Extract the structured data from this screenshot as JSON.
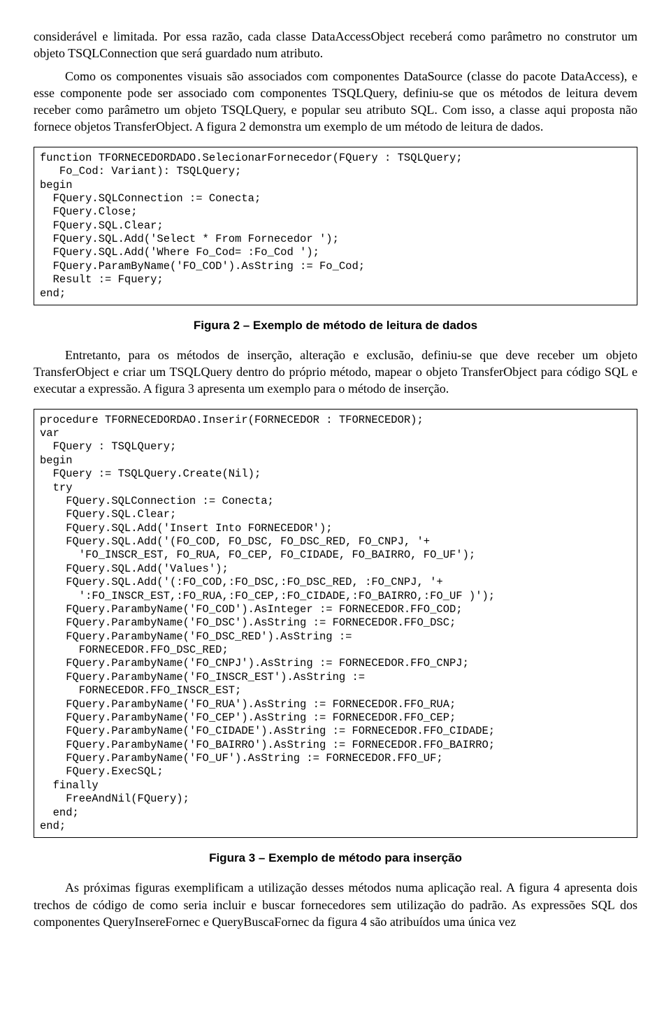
{
  "paragraphs": {
    "p1": "considerável e limitada. Por essa razão, cada classe DataAccessObject receberá como parâmetro no construtor um objeto TSQLConnection que será guardado num atributo.",
    "p2": "Como os componentes visuais são associados com componentes DataSource (classe do pacote DataAccess), e esse componente pode ser associado com componentes TSQLQuery, definiu-se que os métodos de leitura devem receber como parâmetro um objeto TSQLQuery, e popular seu atributo SQL. Com isso, a classe aqui proposta não fornece objetos TransferObject. A figura 2 demonstra um exemplo de um método de leitura de dados.",
    "p3": "Entretanto, para os métodos de inserção, alteração e exclusão, definiu-se que deve receber um objeto TransferObject e criar um TSQLQuery dentro do próprio método, mapear o objeto TransferObject para código SQL e executar a expressão. A figura 3 apresenta um exemplo para o método de inserção.",
    "p4": "As próximas figuras exemplificam a utilização desses métodos numa aplicação real. A figura 4 apresenta dois trechos de código de como seria incluir e buscar fornecedores sem utilização do padrão. As expressões SQL dos componentes QueryInsereFornec e QueryBuscaFornec da figura 4 são atribuídos uma única vez"
  },
  "code": {
    "fig2": "function TFORNECEDORDADO.SelecionarFornecedor(FQuery : TSQLQuery;\n   Fo_Cod: Variant): TSQLQuery;\nbegin\n  FQuery.SQLConnection := Conecta;\n  FQuery.Close;\n  FQuery.SQL.Clear;\n  FQuery.SQL.Add('Select * From Fornecedor ');\n  FQuery.SQL.Add('Where Fo_Cod= :Fo_Cod ');\n  FQuery.ParamByName('FO_COD').AsString := Fo_Cod;\n  Result := Fquery;\nend;",
    "fig3": "procedure TFORNECEDORDAO.Inserir(FORNECEDOR : TFORNECEDOR);\nvar\n  FQuery : TSQLQuery;\nbegin\n  FQuery := TSQLQuery.Create(Nil);\n  try\n    FQuery.SQLConnection := Conecta;\n    FQuery.SQL.Clear;\n    FQuery.SQL.Add('Insert Into FORNECEDOR');\n    FQuery.SQL.Add('(FO_COD, FO_DSC, FO_DSC_RED, FO_CNPJ, '+\n      'FO_INSCR_EST, FO_RUA, FO_CEP, FO_CIDADE, FO_BAIRRO, FO_UF');\n    FQuery.SQL.Add('Values');\n    FQuery.SQL.Add('(:FO_COD,:FO_DSC,:FO_DSC_RED, :FO_CNPJ, '+\n      ':FO_INSCR_EST,:FO_RUA,:FO_CEP,:FO_CIDADE,:FO_BAIRRO,:FO_UF )');\n    FQuery.ParambyName('FO_COD').AsInteger := FORNECEDOR.FFO_COD;\n    FQuery.ParambyName('FO_DSC').AsString := FORNECEDOR.FFO_DSC;\n    FQuery.ParambyName('FO_DSC_RED').AsString :=\n      FORNECEDOR.FFO_DSC_RED;\n    FQuery.ParambyName('FO_CNPJ').AsString := FORNECEDOR.FFO_CNPJ;\n    FQuery.ParambyName('FO_INSCR_EST').AsString :=\n      FORNECEDOR.FFO_INSCR_EST;\n    FQuery.ParambyName('FO_RUA').AsString := FORNECEDOR.FFO_RUA;\n    FQuery.ParambyName('FO_CEP').AsString := FORNECEDOR.FFO_CEP;\n    FQuery.ParambyName('FO_CIDADE').AsString := FORNECEDOR.FFO_CIDADE;\n    FQuery.ParambyName('FO_BAIRRO').AsString := FORNECEDOR.FFO_BAIRRO;\n    FQuery.ParambyName('FO_UF').AsString := FORNECEDOR.FFO_UF;\n    FQuery.ExecSQL;\n  finally\n    FreeAndNil(FQuery);\n  end;\nend;"
  },
  "captions": {
    "fig2": "Figura 2 – Exemplo de método de leitura de dados",
    "fig3": "Figura 3 – Exemplo de método para inserção"
  }
}
